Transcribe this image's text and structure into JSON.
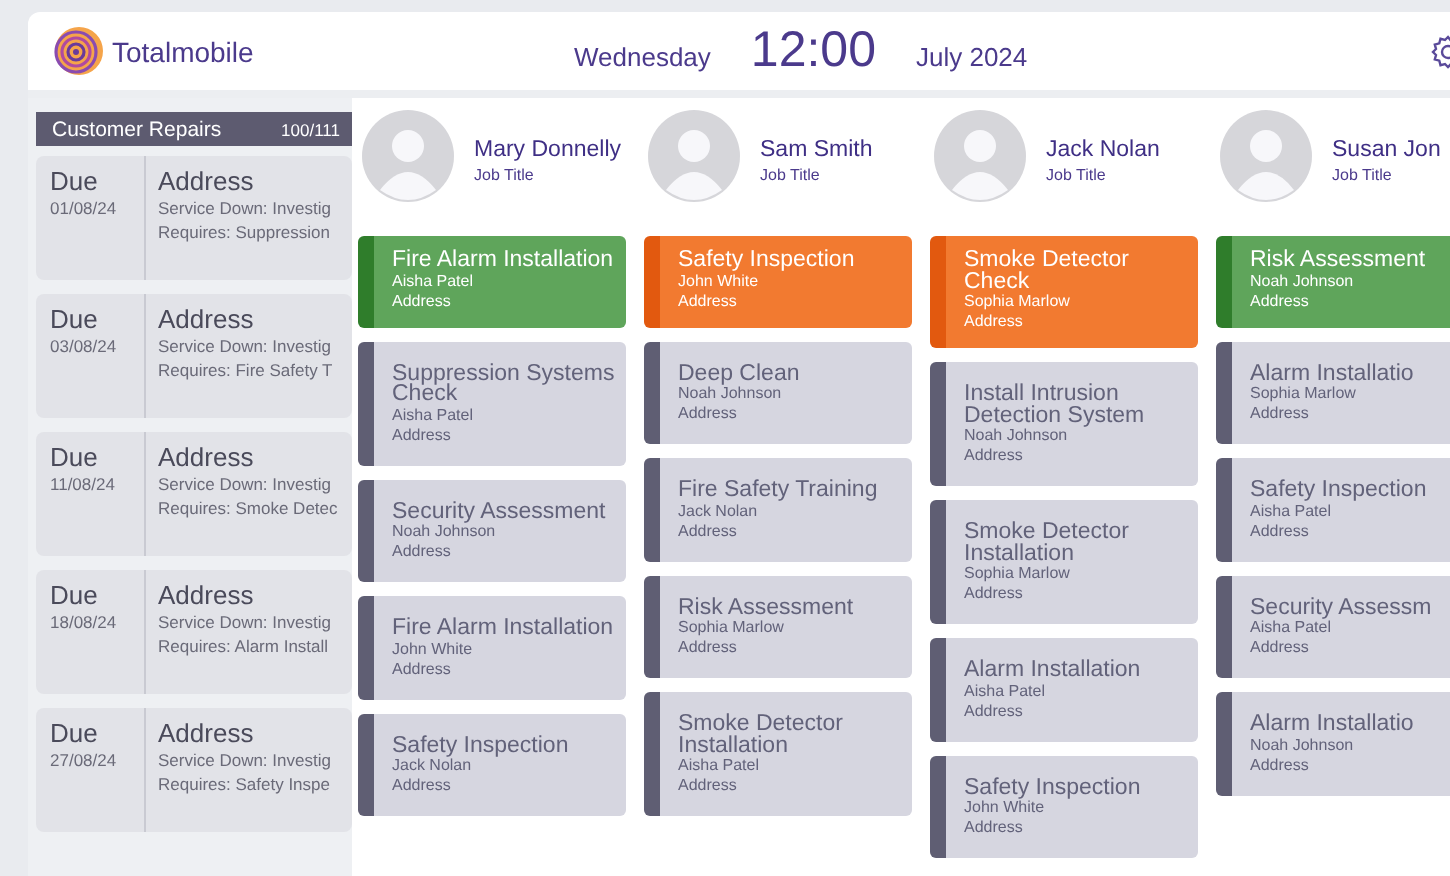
{
  "header": {
    "brand": "Totalmobile",
    "day": "Wednesday",
    "time": "12:00",
    "month": "July 2024"
  },
  "repairs": {
    "title": "Customer Repairs",
    "count": "100/111",
    "items": [
      {
        "due_label": "Due",
        "date": "01/08/24",
        "address": "Address",
        "service": "Service Down: Investig",
        "requires": "Requires: Suppression"
      },
      {
        "due_label": "Due",
        "date": "03/08/24",
        "address": "Address",
        "service": "Service Down: Investig",
        "requires": "Requires: Fire Safety T"
      },
      {
        "due_label": "Due",
        "date": "11/08/24",
        "address": "Address",
        "service": "Service Down: Investig",
        "requires": "Requires: Smoke Detec"
      },
      {
        "due_label": "Due",
        "date": "18/08/24",
        "address": "Address",
        "service": "Service Down: Investig",
        "requires": "Requires: Alarm Install"
      },
      {
        "due_label": "Due",
        "date": "27/08/24",
        "address": "Address",
        "service": "Service Down: Investig",
        "requires": "Requires: Safety Inspe"
      }
    ]
  },
  "engineers": [
    {
      "name": "Mary Donnelly",
      "role": "Job Title",
      "jobs": [
        {
          "title": "Fire Alarm Installation",
          "assignee": "Aisha Patel",
          "address": "Address",
          "kind": "complete"
        },
        {
          "title": "Suppression Systems Check",
          "assignee": "Aisha Patel",
          "address": "Address",
          "kind": "scheduled"
        },
        {
          "title": "Security Assessment",
          "assignee": "Noah Johnson",
          "address": "Address",
          "kind": "scheduled"
        },
        {
          "title": "Fire Alarm Installation",
          "assignee": "John White",
          "address": "Address",
          "kind": "scheduled"
        },
        {
          "title": "Safety Inspection",
          "assignee": "Jack Nolan",
          "address": "Address",
          "kind": "scheduled"
        }
      ]
    },
    {
      "name": "Sam Smith",
      "role": "Job Title",
      "jobs": [
        {
          "title": "Safety Inspection",
          "assignee": "John White",
          "address": "Address",
          "kind": "in_progress"
        },
        {
          "title": "Deep Clean",
          "assignee": "Noah Johnson",
          "address": "Address",
          "kind": "scheduled"
        },
        {
          "title": "Fire Safety Training",
          "assignee": "Jack Nolan",
          "address": "Address",
          "kind": "scheduled"
        },
        {
          "title": "Risk Assessment",
          "assignee": "Sophia Marlow",
          "address": "Address",
          "kind": "scheduled"
        },
        {
          "title": "Smoke Detector Installation",
          "assignee": "Aisha Patel",
          "address": "Address",
          "kind": "scheduled"
        }
      ]
    },
    {
      "name": "Jack Nolan",
      "role": "Job Title",
      "jobs": [
        {
          "title": "Smoke Detector Check",
          "assignee": "Sophia Marlow",
          "address": "Address",
          "kind": "in_progress"
        },
        {
          "title": "Install Intrusion Detection System",
          "assignee": "Noah Johnson",
          "address": "Address",
          "kind": "scheduled"
        },
        {
          "title": "Smoke Detector Installation",
          "assignee": "Sophia Marlow",
          "address": "Address",
          "kind": "scheduled"
        },
        {
          "title": "Alarm Installation",
          "assignee": "Aisha Patel",
          "address": "Address",
          "kind": "scheduled"
        },
        {
          "title": "Safety Inspection",
          "assignee": "John White",
          "address": "Address",
          "kind": "scheduled"
        }
      ]
    },
    {
      "name": "Susan Jon",
      "role": "Job Title",
      "jobs": [
        {
          "title": "Risk Assessment",
          "assignee": "Noah Johnson",
          "address": "Address",
          "kind": "complete"
        },
        {
          "title": "Alarm Installatio",
          "assignee": "Sophia Marlow",
          "address": "Address",
          "kind": "scheduled"
        },
        {
          "title": "Safety Inspection",
          "assignee": "Aisha Patel",
          "address": "Address",
          "kind": "scheduled"
        },
        {
          "title": "Security Assessm",
          "assignee": "Aisha Patel",
          "address": "Address",
          "kind": "scheduled"
        },
        {
          "title": "Alarm Installatio",
          "assignee": "Noah Johnson",
          "address": "Address",
          "kind": "scheduled"
        }
      ]
    }
  ]
}
